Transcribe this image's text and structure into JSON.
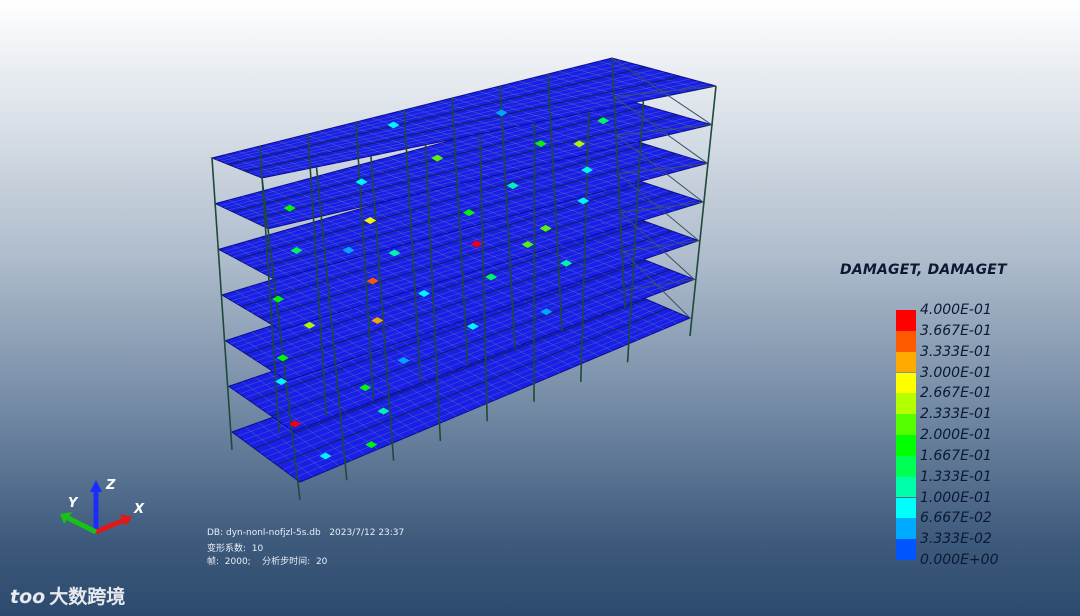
{
  "legend": {
    "title": "DAMAGET, DAMAGET",
    "labels": [
      "4.000E-01",
      "3.667E-01",
      "3.333E-01",
      "3.000E-01",
      "2.667E-01",
      "2.333E-01",
      "2.000E-01",
      "1.667E-01",
      "1.333E-01",
      "1.000E-01",
      "6.667E-02",
      "3.333E-02",
      "0.000E+00"
    ],
    "colors": [
      "#ff0000",
      "#ff5a00",
      "#ffaa00",
      "#ffff00",
      "#b4ff00",
      "#55ff00",
      "#00ff00",
      "#00ff55",
      "#00ffaa",
      "#00ffff",
      "#00aaff",
      "#0055ff",
      "#0000ff"
    ]
  },
  "info": {
    "db_label": "DB: dyn-nonl-nofjzl-5s.db",
    "date": "2023/7/12 23:37",
    "deform_label": "变形系数:",
    "deform_value": "10",
    "frame_label": "帧:",
    "frame_value": "2000;",
    "step_label": "分析步时间:",
    "step_value": "20"
  },
  "triad": {
    "x": "X",
    "y": "Y",
    "z": "Z"
  },
  "watermark": {
    "mark": "too",
    "text": "大数跨境"
  },
  "colors": {
    "slab": "#1a1fe6",
    "mesh": "#5a70c8",
    "frame": "#1e4a3a",
    "hot_red": "#ff1010",
    "hot_orange": "#ff7020"
  }
}
